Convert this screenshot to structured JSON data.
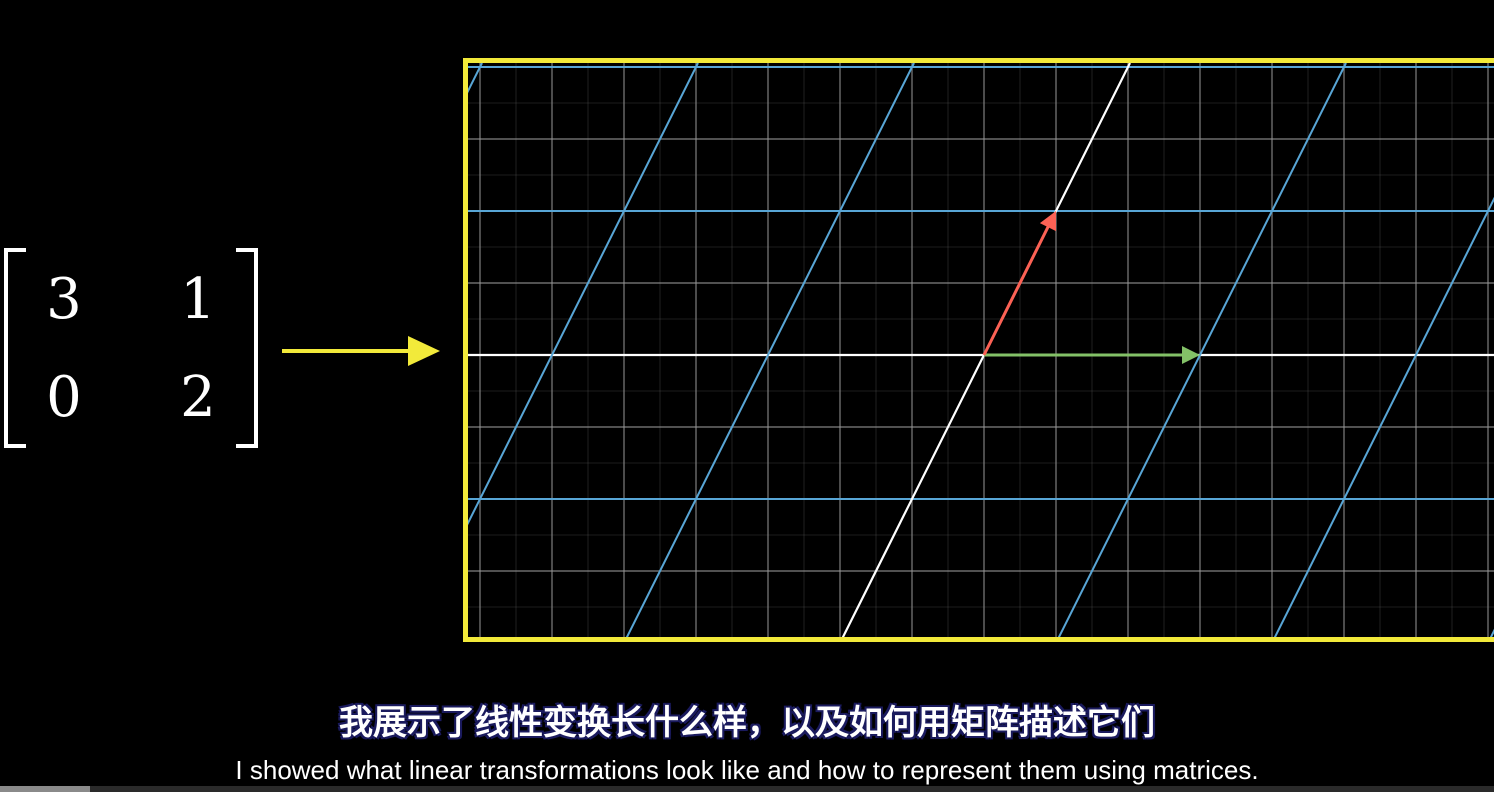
{
  "matrix": {
    "a": "3",
    "b": "1",
    "c": "0",
    "d": "2"
  },
  "colors": {
    "frame": "#f2ea3a",
    "arrow": "#f2ea3a",
    "basis_grid": "#58a6d6",
    "fine_grid": "#9a9a9a",
    "i_hat": "#83c167",
    "j_hat": "#fc6255",
    "axis": "#ffffff"
  },
  "subtitles": {
    "chinese": "我展示了线性变换长什么样，以及如何用矩阵描述它们",
    "english": "I showed what linear transformations look like and how to represent them using matrices."
  },
  "progress": 0.06
}
